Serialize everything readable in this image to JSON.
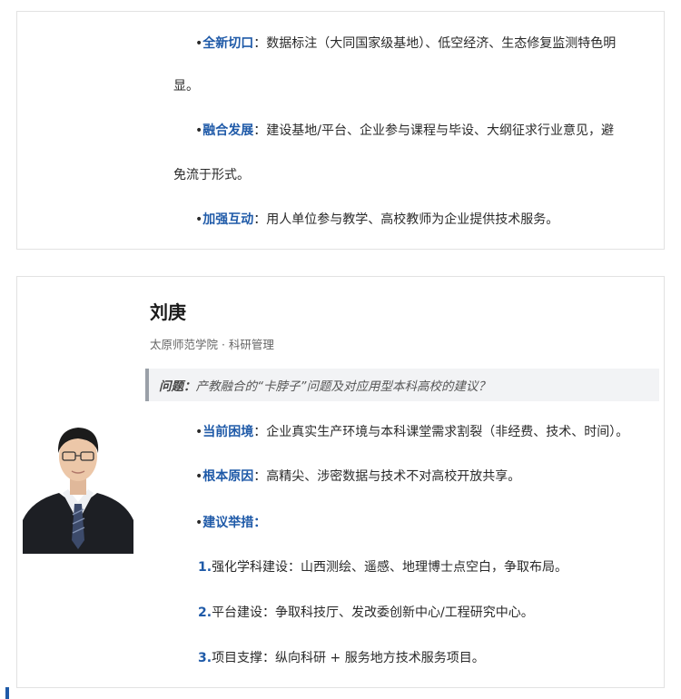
{
  "top_card": {
    "items": [
      {
        "label": "全新切口",
        "line1": "数据标注（大同国家级基地）、低空经济、生态修复监测特色明",
        "line2": "显。"
      },
      {
        "label": "融合发展",
        "line1": "建设基地/平台、企业参与课程与毕设、大纲征求行业意见，避",
        "line2": "免流于形式。"
      },
      {
        "label": "加强互动",
        "line1": "用人单位参与教学、高校教师为企业提供技术服务。",
        "line2": ""
      }
    ]
  },
  "profile": {
    "name": "刘庚",
    "affiliation": "太原师范学院 · 科研管理",
    "question_label": "问题：",
    "question_text": "产教融合的“卡脖子”问题及对应用型本科高校的建议？",
    "bullets": [
      {
        "label": "当前困境",
        "text": "企业真实生产环境与本科课堂需求割裂（非经费、技术、时间）。"
      },
      {
        "label": "根本原因",
        "text": "高精尖、涉密数据与技术不对高校开放共享。"
      },
      {
        "label": "建议举措",
        "text": ""
      }
    ],
    "measures": [
      {
        "num": "1.",
        "text": "强化学科建设：山西测绘、遥感、地理博士点空白，争取布局。"
      },
      {
        "num": "2.",
        "text": "平台建设：争取科技厅、发改委创新中心/工程研究中心。"
      },
      {
        "num": "3.",
        "text": "项目支撑：纵向科研 + 服务地方技术服务项目。"
      }
    ]
  },
  "colors": {
    "accent": "#1f5aa8",
    "border": "#e2e2e2",
    "question_bg": "#f2f3f5"
  }
}
